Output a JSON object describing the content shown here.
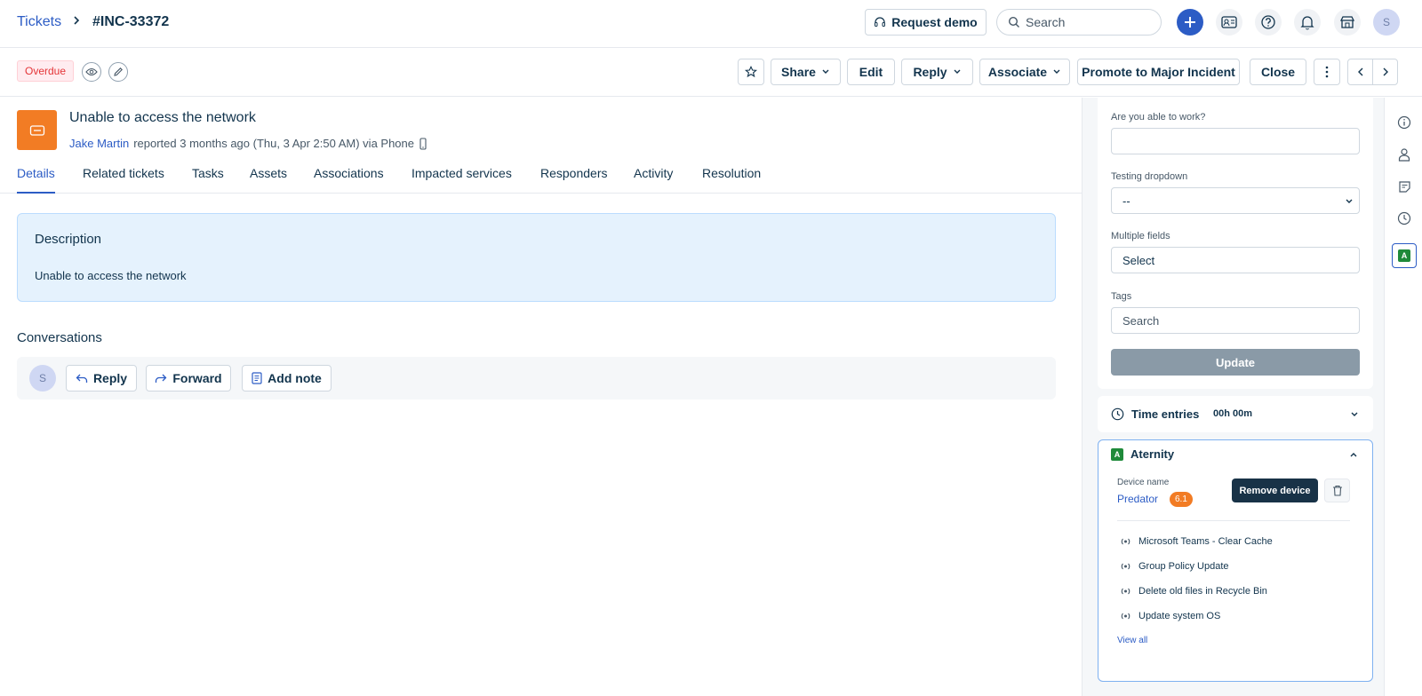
{
  "header": {
    "breadcrumb_root": "Tickets",
    "breadcrumb_sep": ">",
    "ticket_id": "#INC-33372",
    "request_demo": "Request demo",
    "search_placeholder": "Search",
    "avatar_initial": "S"
  },
  "toolbar": {
    "status_badge": "Overdue",
    "share": "Share",
    "edit": "Edit",
    "reply": "Reply",
    "associate": "Associate",
    "promote": "Promote to Major Incident",
    "close": "Close"
  },
  "ticket": {
    "subject": "Unable to access the network",
    "requester": "Jake Martin",
    "reported": "reported 3 months ago (Thu, 3 Apr 2:50 AM) via Phone"
  },
  "tabs": [
    "Details",
    "Related tickets",
    "Tasks",
    "Assets",
    "Associations",
    "Impacted services",
    "Responders",
    "Activity",
    "Resolution"
  ],
  "description": {
    "heading": "Description",
    "body": "Unable to access the network"
  },
  "conversations": {
    "title": "Conversations",
    "avatar": "S",
    "reply": "Reply",
    "forward": "Forward",
    "add_note": "Add note"
  },
  "properties": {
    "work_label": "Are you able to work?",
    "work_value": "",
    "dropdown_label": "Testing dropdown",
    "dropdown_value": "--",
    "multi_label": "Multiple fields",
    "multi_value": "Select",
    "tags_label": "Tags",
    "tags_placeholder": "Search",
    "update": "Update"
  },
  "time_entries": {
    "label": "Time entries",
    "value": "00h 00m"
  },
  "aternity": {
    "badge": "A",
    "title": "Aternity",
    "device_label": "Device name",
    "device_name": "Predator",
    "score": "6.1",
    "remove": "Remove device",
    "actions": [
      "Microsoft Teams - Clear Cache",
      "Group Policy Update",
      "Delete old files in Recycle Bin",
      "Update system OS"
    ],
    "view_all": "View all"
  },
  "colors": {
    "accent": "#2c5cc5",
    "orange": "#f27c24",
    "update_disabled": "#8a9aa7",
    "aternity_green": "#1f8a3a",
    "dark_button": "#183247"
  }
}
